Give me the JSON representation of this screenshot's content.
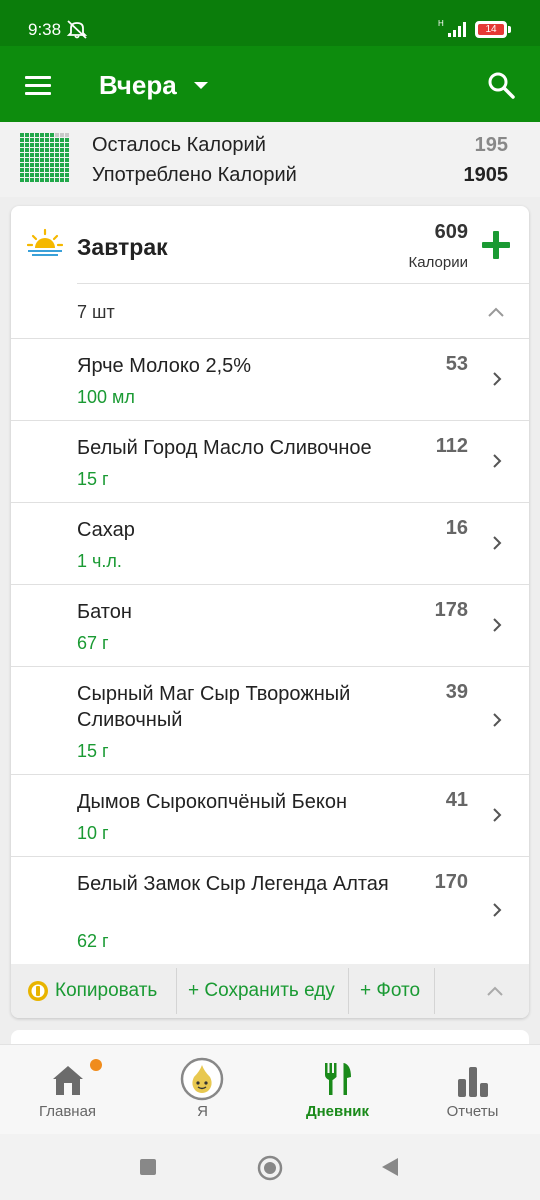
{
  "status_bar": {
    "time": "9:38",
    "battery": "14",
    "network": "H"
  },
  "toolbar": {
    "title": "Вчера",
    "menu_icon": "hamburger-menu-icon",
    "search_icon": "search-icon"
  },
  "summary": {
    "remaining_label": "Осталось Калорий",
    "remaining_value": "195",
    "consumed_label": "Употреблено Калорий",
    "consumed_value": "1905"
  },
  "meal": {
    "icon": "sunrise-icon",
    "title": "Завтрак",
    "calories": "609",
    "calories_label": "Калории",
    "count": "7 шт",
    "items": [
      {
        "name": "Ярче Молоко 2,5%",
        "calories": "53",
        "amount": "100 мл"
      },
      {
        "name": "Белый Город Масло Сливочное",
        "calories": "112",
        "amount": "15 г"
      },
      {
        "name": "Сахар",
        "calories": "16",
        "amount": "1 ч.л."
      },
      {
        "name": "Батон",
        "calories": "178",
        "amount": "67 г"
      },
      {
        "name": "Сырный Маг Сыр Творожный Сливочный",
        "calories": "39",
        "amount": "15 г"
      },
      {
        "name": "Дымов Сырокопчёный Бекон",
        "calories": "41",
        "amount": "10 г"
      },
      {
        "name": "Белый Замок Сыр Легенда Алтая",
        "calories": "170",
        "amount": "62 г"
      }
    ],
    "actions": {
      "copy": "Копировать",
      "save": "+ Сохранить еду",
      "photo": "+ Фото"
    }
  },
  "bottom_nav": [
    {
      "label": "Главная",
      "icon": "home-icon"
    },
    {
      "label": "Я",
      "icon": "onion-avatar-icon"
    },
    {
      "label": "Дневник",
      "icon": "fork-knife-icon"
    },
    {
      "label": "Отчеты",
      "icon": "bar-chart-icon"
    }
  ],
  "colors": {
    "status_bar": "#0b7d0b",
    "toolbar": "#0d8c0d",
    "accent_green": "#1a9a33",
    "notification_dot": "#f08c1c"
  }
}
